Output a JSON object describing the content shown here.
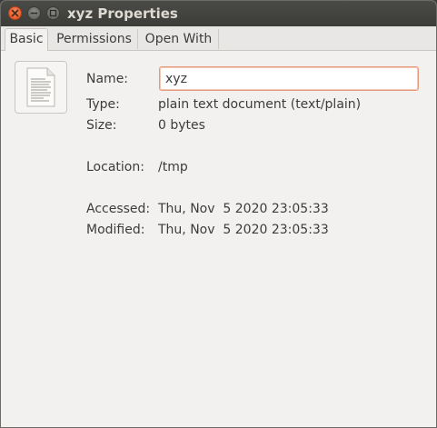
{
  "window": {
    "title": "xyz Properties"
  },
  "tabs": [
    {
      "label": "Basic",
      "active": true
    },
    {
      "label": "Permissions",
      "active": false
    },
    {
      "label": "Open With",
      "active": false
    }
  ],
  "basic": {
    "file_icon": "text-document-icon",
    "name_label": "Name:",
    "name_value": "xyz",
    "type_label": "Type:",
    "type_value": "plain text document (text/plain)",
    "size_label": "Size:",
    "size_value": "0 bytes",
    "location_label": "Location:",
    "location_value": "/tmp",
    "accessed_label": "Accessed:",
    "accessed_value": "Thu, Nov  5 2020 23:05:33",
    "modified_label": "Modified:",
    "modified_value": "Thu, Nov  5 2020 23:05:33"
  },
  "colors": {
    "titlebar": "#3c3c39",
    "close_button": "#e1521a",
    "focus_border": "#e99a7d",
    "background": "#f2f1f0"
  }
}
